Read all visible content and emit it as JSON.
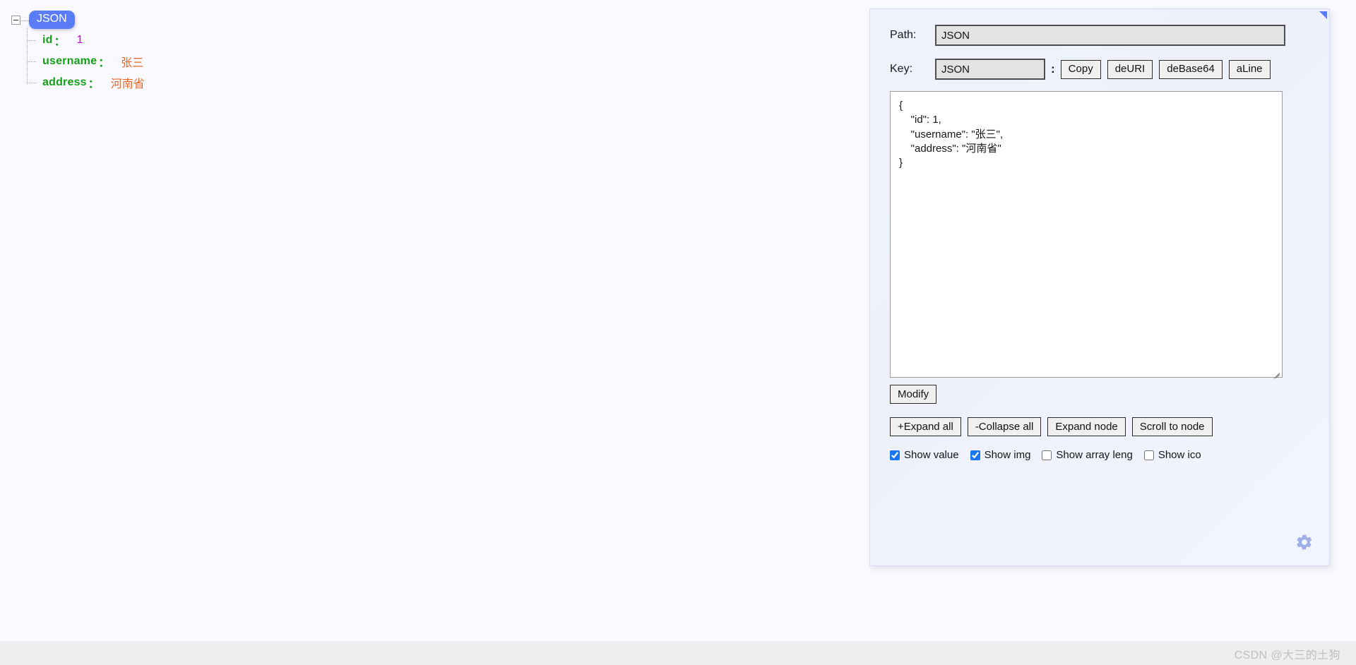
{
  "tree": {
    "root_label": "JSON",
    "collapse_icon": "minus-square-icon",
    "nodes": [
      {
        "key": "id",
        "separator": "：",
        "value": "1",
        "value_type": "number"
      },
      {
        "key": "username",
        "separator": "：",
        "value": "张三",
        "value_type": "string"
      },
      {
        "key": "address",
        "separator": "：",
        "value": "河南省",
        "value_type": "string"
      }
    ],
    "colors": {
      "root_badge_bg": "#5b7cf7",
      "key": "#15a018",
      "number_value": "#cc00cc",
      "string_value": "#e2692b"
    }
  },
  "panel": {
    "corner_icon": "resize-corner-icon",
    "path": {
      "label": "Path:",
      "value": "JSON",
      "placeholder": ""
    },
    "key": {
      "label": "Key:",
      "value": "JSON",
      "placeholder": "",
      "colon": ":"
    },
    "key_buttons": [
      {
        "label": "Copy",
        "name": "copy-button"
      },
      {
        "label": "deURI",
        "name": "deuri-button"
      },
      {
        "label": "deBase64",
        "name": "debase64-button"
      },
      {
        "label": "aLine",
        "name": "aline-button"
      }
    ],
    "editor": {
      "content": "{\n    \"id\": 1,\n    \"username\": \"张三\",\n    \"address\": \"河南省\"\n}",
      "placeholder": ""
    },
    "modify_button": {
      "label": "Modify"
    },
    "nav_buttons": [
      {
        "label": "+Expand all",
        "name": "expand-all-button"
      },
      {
        "label": "-Collapse all",
        "name": "collapse-all-button"
      },
      {
        "label": "Expand node",
        "name": "expand-node-button"
      },
      {
        "label": "Scroll to node",
        "name": "scroll-to-node-button"
      }
    ],
    "checkboxes": [
      {
        "label": "Show value",
        "checked": true
      },
      {
        "label": "Show img",
        "checked": true
      },
      {
        "label": "Show array leng",
        "checked": false
      },
      {
        "label": "Show ico",
        "checked": false
      }
    ],
    "settings_icon": "gear-icon",
    "accent_color": "#5b7cf7",
    "checkbox_color": "#1777f2"
  },
  "watermark": {
    "text": "CSDN @大三的土狗"
  }
}
